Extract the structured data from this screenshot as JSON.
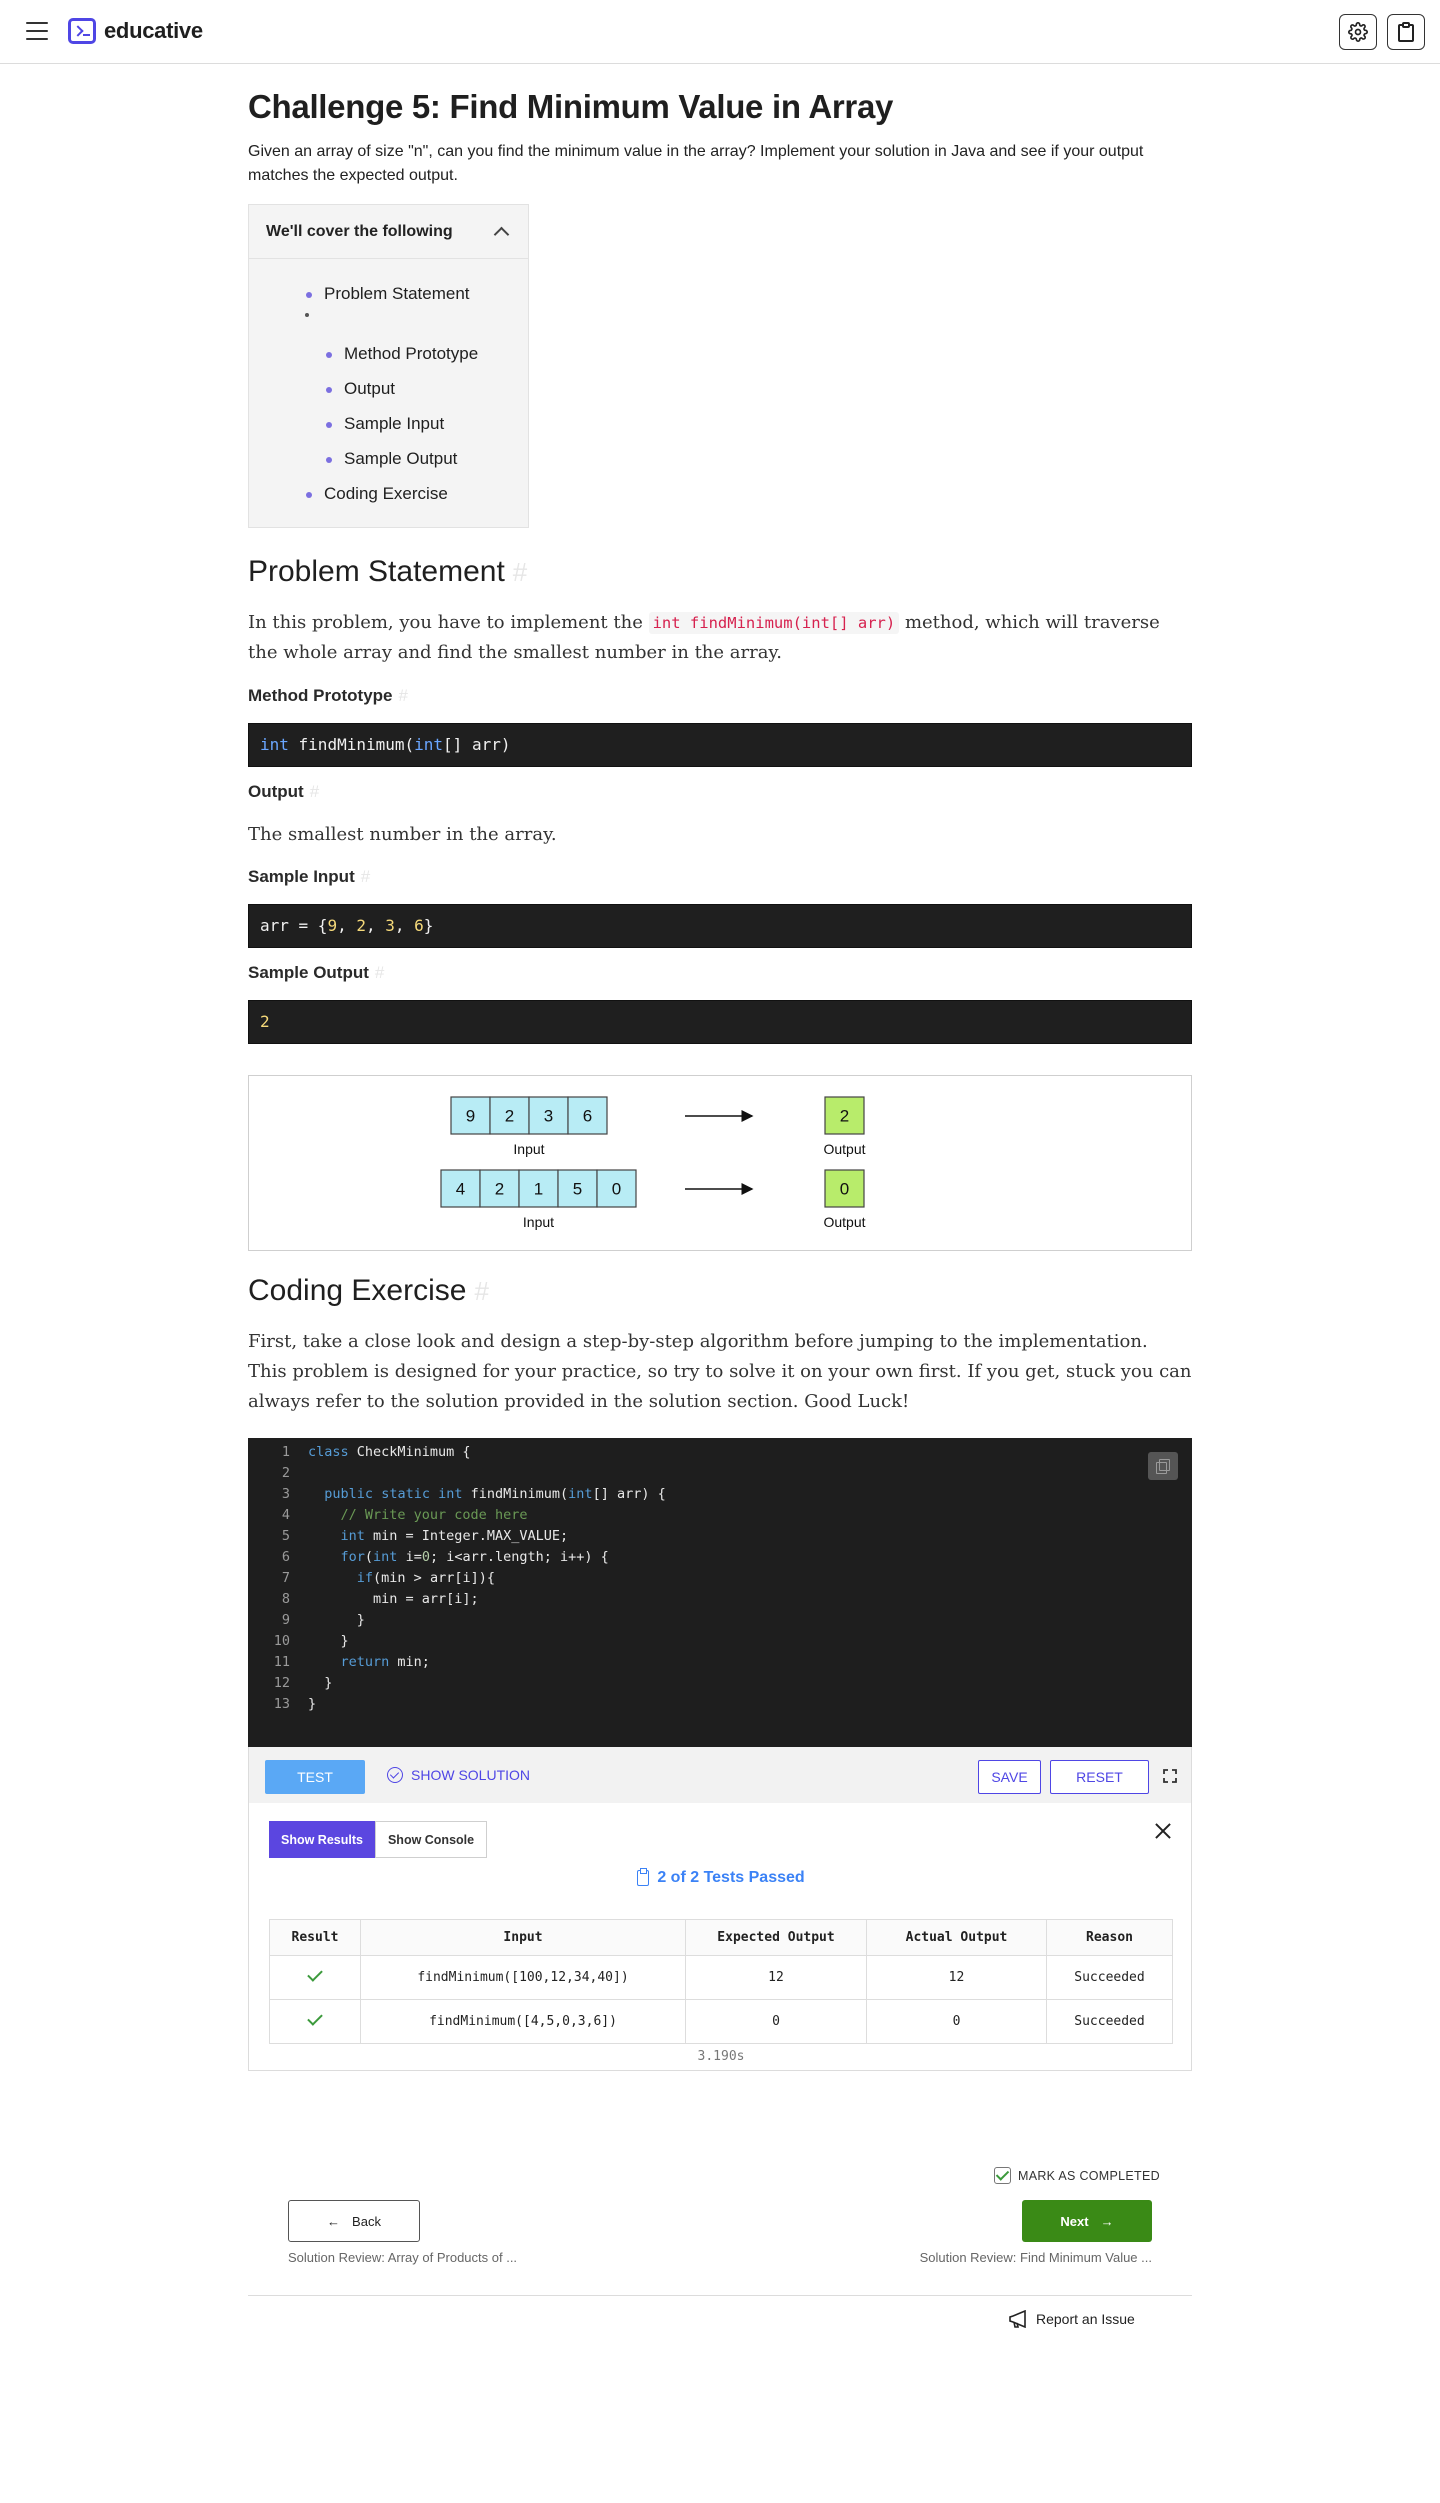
{
  "app": {
    "brand": "educative"
  },
  "page": {
    "title": "Challenge 5: Find Minimum Value in Array",
    "intro": "Given an array of size \"n\", can you find the minimum value in the array? Implement your solution in Java and see if your output matches the expected output."
  },
  "toc": {
    "heading": "We'll cover the following",
    "items": [
      "Problem Statement",
      "Method Prototype",
      "Output",
      "Sample Input",
      "Sample Output",
      "Coding Exercise"
    ]
  },
  "problem": {
    "heading": "Problem Statement",
    "text_before": "In this problem, you have to implement the ",
    "inline_code": "int findMinimum(int[] arr)",
    "text_after": " method, which will traverse the whole array and find the smallest number in the array.",
    "method_heading": "Method Prototype",
    "method_code": {
      "type": "int",
      "name": " findMinimum(",
      "param_type": "int",
      "rest": "[] arr)"
    },
    "output_heading": "Output",
    "output_text": "The smallest number in the array.",
    "sample_input_heading": "Sample Input",
    "sample_input": {
      "prefix": "arr = {",
      "values": [
        "9",
        "2",
        "3",
        "6"
      ],
      "suffix": "}"
    },
    "sample_output_heading": "Sample Output",
    "sample_output": "2"
  },
  "figure": {
    "examples": [
      {
        "input": [
          "9",
          "2",
          "3",
          "6"
        ],
        "input_label": "Input",
        "output": "2",
        "output_label": "Output"
      },
      {
        "input": [
          "4",
          "2",
          "1",
          "5",
          "0"
        ],
        "input_label": "Input",
        "output": "0",
        "output_label": "Output"
      }
    ],
    "colors": {
      "input_cell": "#b8ecf5",
      "output_cell": "#b8ec6b"
    }
  },
  "exercise": {
    "heading": "Coding Exercise",
    "text": "First, take a close look and design a step-by-step algorithm before jumping to the implementation. This problem is designed for your practice, so try to solve it on your own first. If you get, stuck you can always refer to the solution provided in the solution section. Good Luck!"
  },
  "editor": {
    "lines": [
      {
        "n": "1",
        "text": "class CheckMinimum {"
      },
      {
        "n": "2",
        "text": ""
      },
      {
        "n": "3",
        "text": "  public static int findMinimum(int[] arr) {"
      },
      {
        "n": "4",
        "text": "    // Write your code here"
      },
      {
        "n": "5",
        "text": "    int min = Integer.MAX_VALUE;"
      },
      {
        "n": "6",
        "text": "    for(int i=0; i<arr.length; i++) {"
      },
      {
        "n": "7",
        "text": "      if(min > arr[i]){"
      },
      {
        "n": "8",
        "text": "        min = arr[i];"
      },
      {
        "n": "9",
        "text": "      }"
      },
      {
        "n": "10",
        "text": "    }"
      },
      {
        "n": "11",
        "text": "    return min;"
      },
      {
        "n": "12",
        "text": "  }"
      },
      {
        "n": "13",
        "text": "}"
      }
    ],
    "test_label": "TEST",
    "show_solution_label": "SHOW SOLUTION",
    "save_label": "SAVE",
    "reset_label": "RESET"
  },
  "results": {
    "tab_results": "Show Results",
    "tab_console": "Show Console",
    "summary": "2 of 2 Tests Passed",
    "columns": [
      "Result",
      "Input",
      "Expected Output",
      "Actual Output",
      "Reason"
    ],
    "rows": [
      {
        "input": "findMinimum([100,12,34,40])",
        "expected": "12",
        "actual": "12",
        "reason": "Succeeded"
      },
      {
        "input": "findMinimum([4,5,0,3,6])",
        "expected": "0",
        "actual": "0",
        "reason": "Succeeded"
      }
    ],
    "time": "3.190s"
  },
  "nav": {
    "mark_completed": "MARK AS COMPLETED",
    "back_label": "Back",
    "next_label": "Next",
    "back_caption": "Solution Review: Array of Products of ...",
    "next_caption": "Solution Review: Find Minimum Value ...",
    "report": "Report an Issue"
  }
}
